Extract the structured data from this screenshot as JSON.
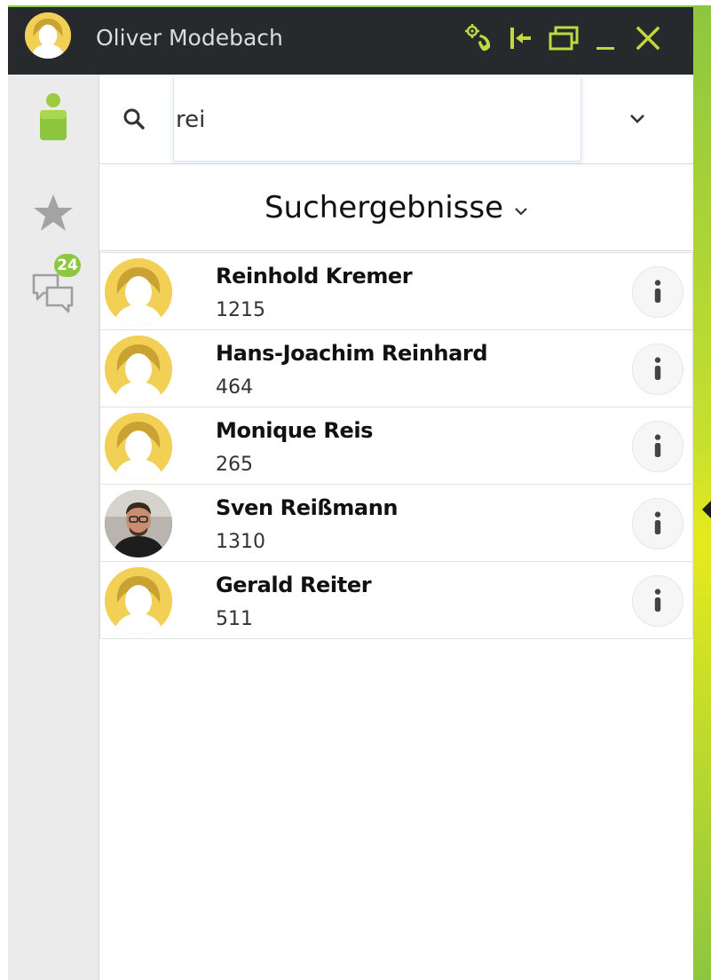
{
  "window": {
    "user_name": "Oliver Modebach",
    "accent_color": "#8dc63f",
    "titlebar_color": "#262a2d",
    "titlebar_icons": [
      "phone-settings-icon",
      "pin-left-icon",
      "restore-window-icon",
      "minimize-icon",
      "close-icon"
    ]
  },
  "sidebar": {
    "items": [
      {
        "icon": "contact-person-icon",
        "active": true
      },
      {
        "icon": "star-icon",
        "active": false
      },
      {
        "icon": "chat-bubbles-icon",
        "badge": "24",
        "active": false
      }
    ]
  },
  "search": {
    "value": "rei",
    "icon": "search-icon",
    "dropdown_icon": "chevron-down-icon"
  },
  "results": {
    "title": "Suchergebnisse",
    "contacts": [
      {
        "name": "Reinhold Kremer",
        "extension": "1215",
        "avatar": "placeholder"
      },
      {
        "name": "Hans-Joachim Reinhard",
        "extension": "464",
        "avatar": "placeholder"
      },
      {
        "name": "Monique Reis",
        "extension": "265",
        "avatar": "placeholder"
      },
      {
        "name": "Sven Reißmann",
        "extension": "1310",
        "avatar": "photo"
      },
      {
        "name": "Gerald Reiter",
        "extension": "511",
        "avatar": "placeholder"
      }
    ]
  }
}
